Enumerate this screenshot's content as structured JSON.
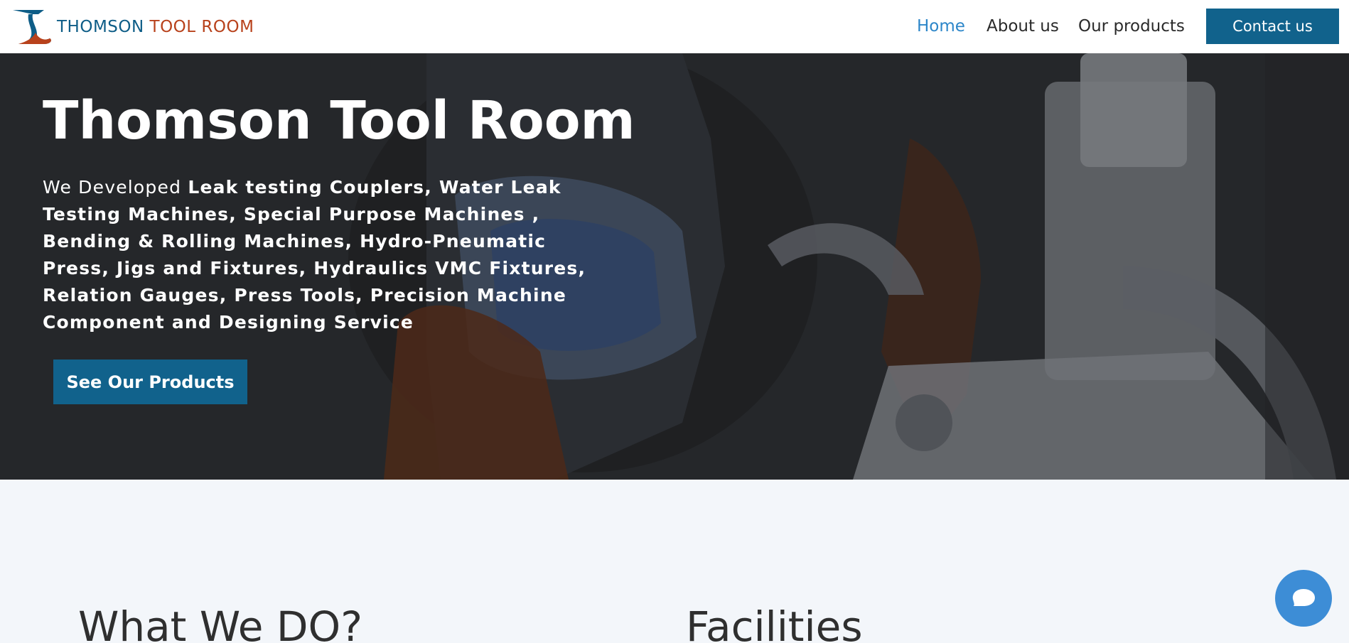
{
  "brand": {
    "name_part1": "THOMSON",
    "name_part2": "TOOL ROOM",
    "color_primary": "#0e5d87",
    "color_secondary": "#b8421c"
  },
  "nav": {
    "items": [
      {
        "label": "Home",
        "active": true
      },
      {
        "label": "About us",
        "active": false
      },
      {
        "label": "Our products",
        "active": false
      }
    ],
    "contact_label": "Contact us"
  },
  "hero": {
    "title": "Thomson Tool Room",
    "desc_intro": "We Developed",
    "desc_bold": "Leak testing Couplers, Water Leak Testing Machines, Special Purpose Machines , Bending & Rolling Machines, Hydro-Pneumatic Press, Jigs and Fixtures, Hydraulics VMC Fixtures, Relation Gauges, Press Tools, Precision Machine Component and Designing Service",
    "cta_label": "See Our Products"
  },
  "sections": {
    "what_title": "What We DO?",
    "facilities_title": "Facilities"
  },
  "chat": {
    "icon": "chat-bubble-icon"
  },
  "colors": {
    "accent": "#11628c",
    "active_link": "#2c86c9",
    "chat": "#3d8dd6"
  }
}
